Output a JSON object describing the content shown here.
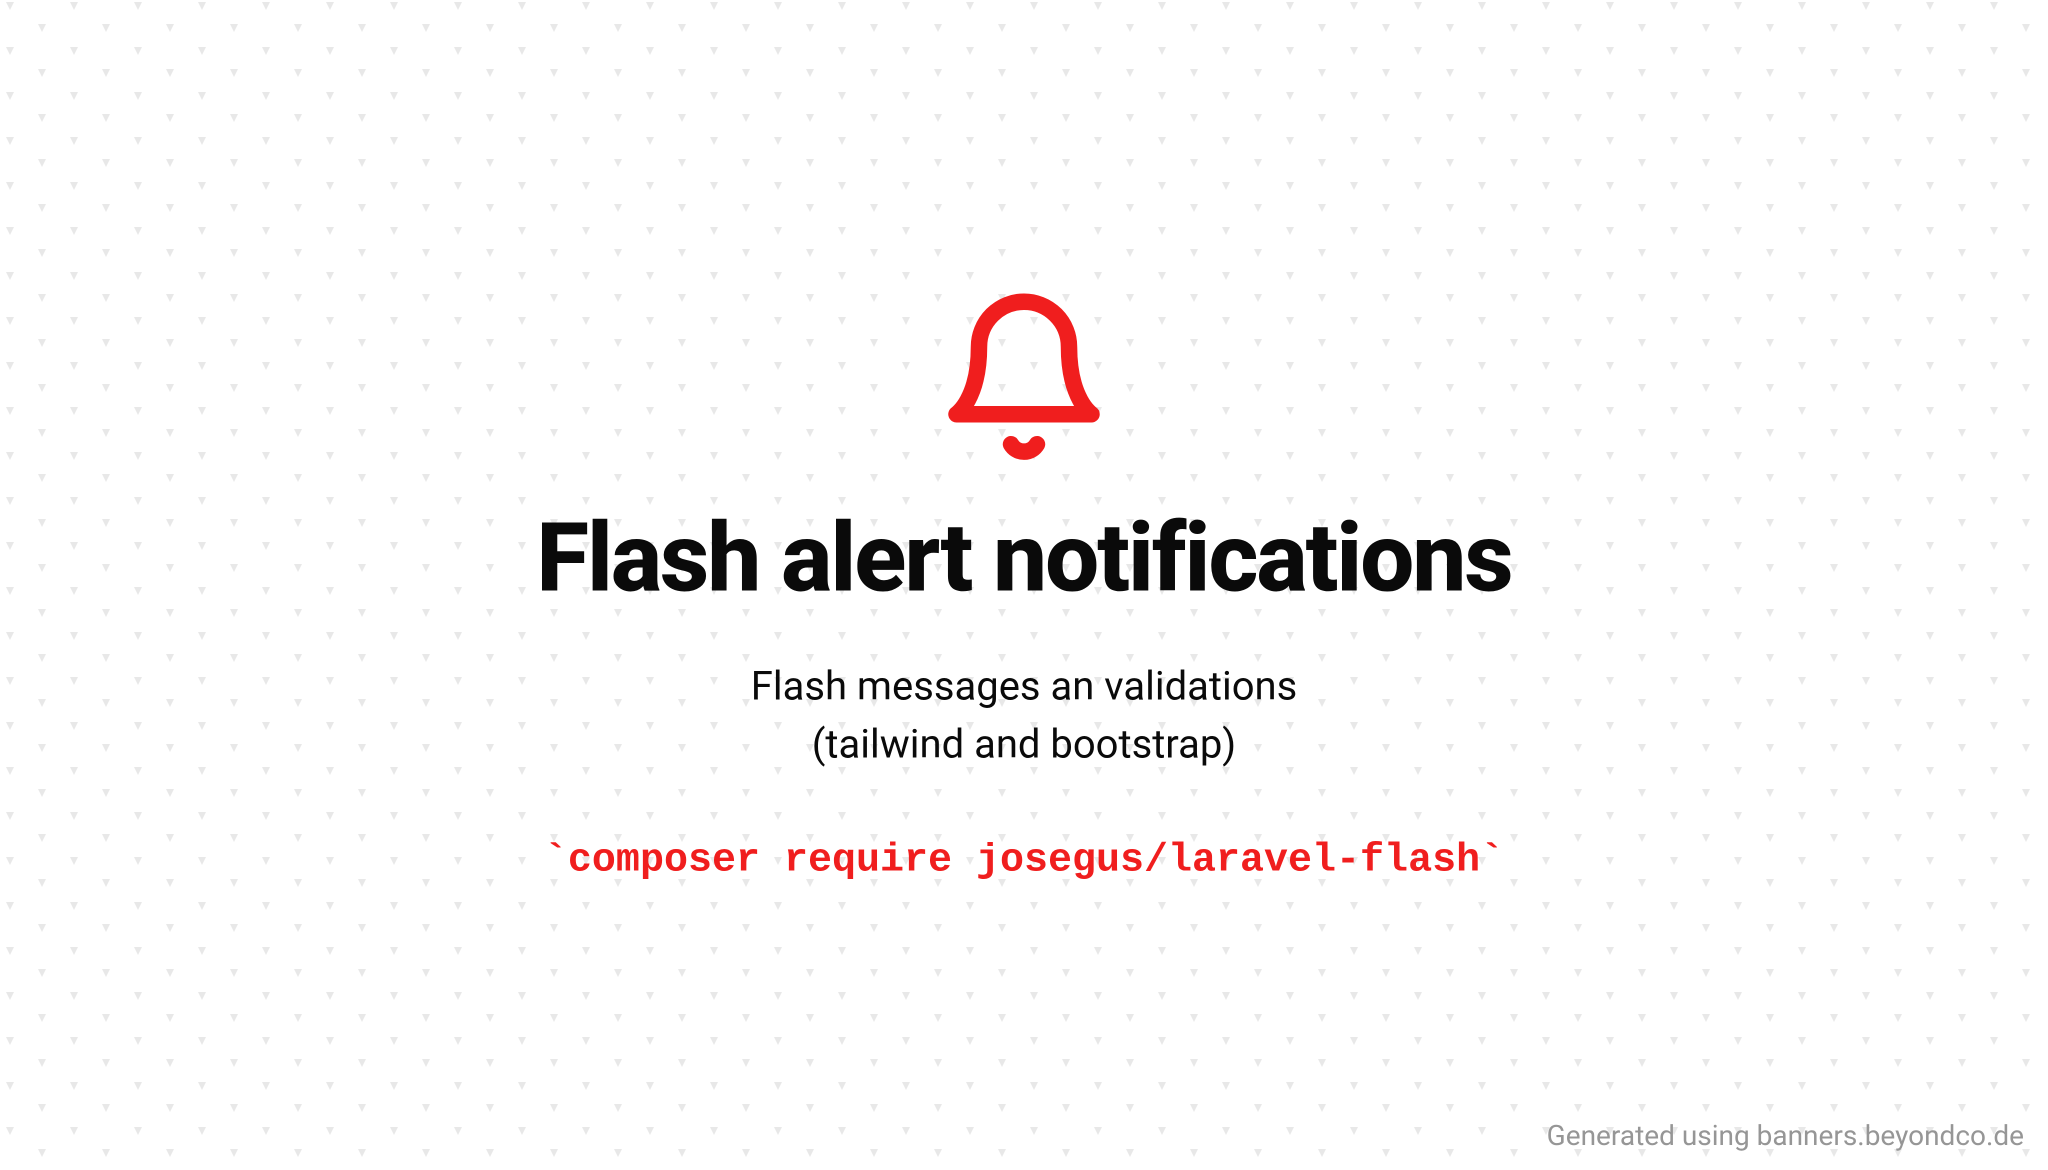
{
  "banner": {
    "title": "Flash alert notifications",
    "subtitle_line1": "Flash messages an validations",
    "subtitle_line2": "(tailwind and bootstrap)",
    "command": "`composer require josegus/laravel-flash`",
    "icon_color": "#f01e1e"
  },
  "attribution": "Generated using banners.beyondco.de"
}
